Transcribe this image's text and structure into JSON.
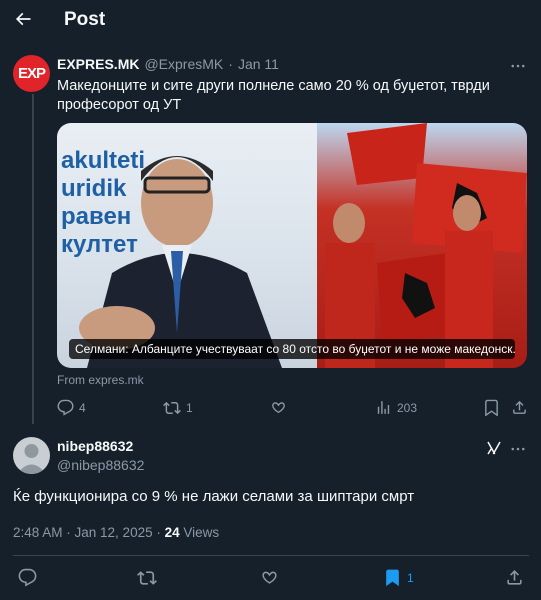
{
  "header": {
    "title": "Post"
  },
  "quoted": {
    "avatar_text": "EXP",
    "name": "EXPRES.MK",
    "handle": "@ExpresMK",
    "date": "Jan 11",
    "text": "Македонците и сите други полнеле само 20 % од буџетот, тврди професорот од УТ",
    "image_wall_text": "akulteti\nuridik\nравен\nкултет",
    "image_caption": "Селмани: Албанците учествуваат со 80 отсто во буџетот и не може македонск...",
    "from_link": "From expres.mk",
    "replies": "4",
    "reposts": "1",
    "likes": "",
    "views": "203"
  },
  "main": {
    "name": "nibep88632",
    "handle": "@nibep88632",
    "text": "Ќе функционира со 9 % не лажи селами за шиптари смрт",
    "timestamp": "2:48 AM · Jan 12, 2025 · ",
    "views_count": "24",
    "views_label": " Views",
    "bookmarks": "1"
  },
  "colors": {
    "background": "#15202b",
    "accent": "#1d9bf0",
    "muted": "#8b98a5",
    "avatar_red": "#e0242a"
  }
}
